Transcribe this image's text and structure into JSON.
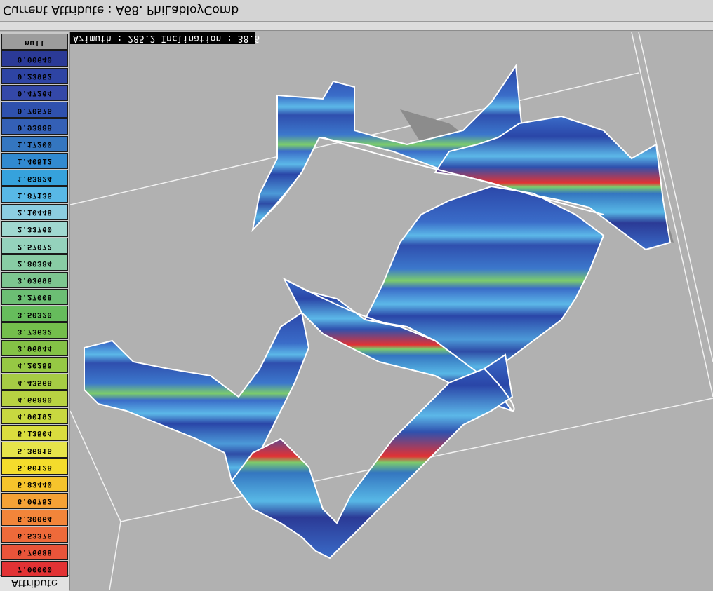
{
  "window": {
    "title": "Current Attribute : A68. PhiLabloyComb"
  },
  "viewer": {
    "orientation": "Azimuth : 285.2    Inclination :  38.6"
  },
  "legend": {
    "footer": "Attribute",
    "entries": [
      {
        "label": "null",
        "color": "#9c9c9c"
      },
      {
        "label": "0.00640",
        "color": "#2b3a96"
      },
      {
        "label": "0.23952",
        "color": "#2e44a4"
      },
      {
        "label": "0.47264",
        "color": "#3448a8"
      },
      {
        "label": "0.70576",
        "color": "#2f51ae"
      },
      {
        "label": "0.93888",
        "color": "#3460b6"
      },
      {
        "label": "1.17200",
        "color": "#3476c0"
      },
      {
        "label": "1.40512",
        "color": "#318ad0"
      },
      {
        "label": "1.63824",
        "color": "#36a2dc"
      },
      {
        "label": "1.87136",
        "color": "#58b8e6"
      },
      {
        "label": "2.10448",
        "color": "#8ccde0"
      },
      {
        "label": "2.33760",
        "color": "#a0d8d0"
      },
      {
        "label": "2.57072",
        "color": "#94d2bc"
      },
      {
        "label": "2.80384",
        "color": "#88cca4"
      },
      {
        "label": "3.03696",
        "color": "#7dc690"
      },
      {
        "label": "3.27008",
        "color": "#6cbe74"
      },
      {
        "label": "3.50320",
        "color": "#66bc5c"
      },
      {
        "label": "3.73632",
        "color": "#74be4c"
      },
      {
        "label": "3.96944",
        "color": "#84c246"
      },
      {
        "label": "4.20256",
        "color": "#96c844"
      },
      {
        "label": "4.43568",
        "color": "#a6cc44"
      },
      {
        "label": "4.66880",
        "color": "#b8d242"
      },
      {
        "label": "4.90192",
        "color": "#c8d840"
      },
      {
        "label": "5.13504",
        "color": "#dadd3e"
      },
      {
        "label": "5.36816",
        "color": "#e6e44a"
      },
      {
        "label": "5.60128",
        "color": "#f4dc2c"
      },
      {
        "label": "5.83440",
        "color": "#f6c42c"
      },
      {
        "label": "6.06752",
        "color": "#f5a236"
      },
      {
        "label": "6.30064",
        "color": "#f2853a"
      },
      {
        "label": "6.53376",
        "color": "#ee6a3a"
      },
      {
        "label": "6.76688",
        "color": "#e9543a"
      },
      {
        "label": "7.00000",
        "color": "#e23234"
      }
    ]
  },
  "colors": {
    "band_dark": "#2a46a8",
    "band_mid": "#3a6cc8",
    "band_light": "#5cb8e8",
    "band_green": "#7ccc6c",
    "band_red": "#e23234",
    "background": "#b1b1b1",
    "shadow": "#8a8a8a"
  }
}
